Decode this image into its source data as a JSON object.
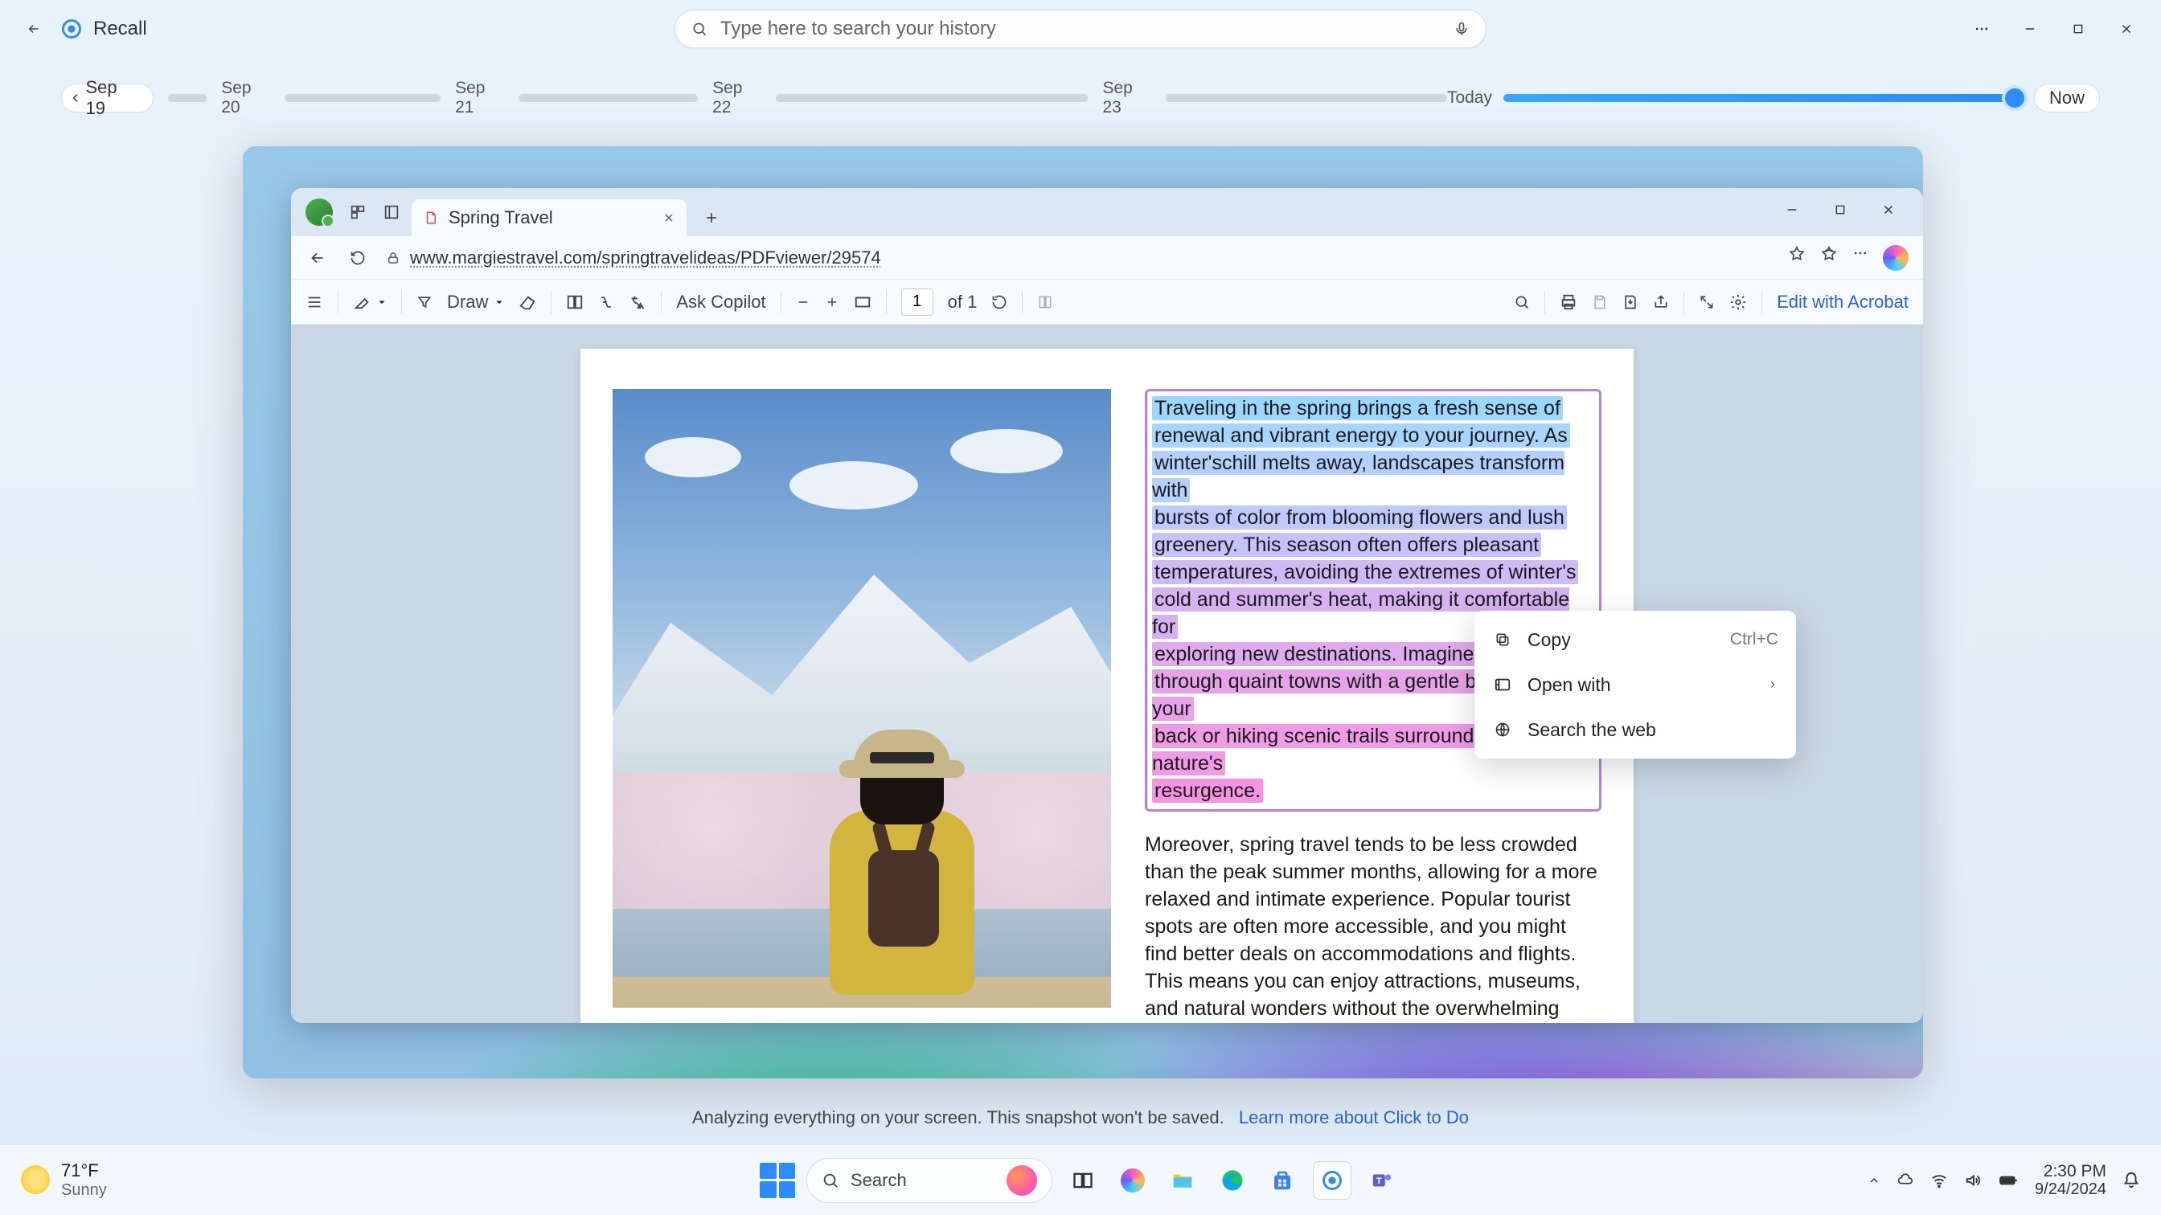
{
  "recall": {
    "title": "Recall",
    "search_placeholder": "Type here to search your history",
    "timeline": {
      "start_date": "Sep 19",
      "dates": [
        "Sep 20",
        "Sep 21",
        "Sep 22",
        "Sep 23"
      ],
      "today_label": "Today",
      "now_label": "Now"
    }
  },
  "status": {
    "text": "Analyzing everything on your screen. This snapshot won't be saved.",
    "link": "Learn more about Click to Do"
  },
  "edge": {
    "tab_title": "Spring Travel",
    "url": "www.margiestravel.com/springtravelideas/PDFviewer/29574",
    "pdf_toolbar": {
      "draw": "Draw",
      "ask_copilot": "Ask Copilot",
      "page_current": "1",
      "page_total": "of 1",
      "edit_acrobat": "Edit with Acrobat"
    },
    "document": {
      "highlighted_lines": [
        "Traveling in the spring brings a fresh sense of",
        "renewal and vibrant energy to your journey. As",
        "winter'schill melts away, landscapes transform with",
        "bursts of color from blooming flowers and lush",
        "greenery. This season often offers pleasant",
        "temperatures, avoiding the extremes of winter's",
        "cold and summer's heat, making it comfortable for",
        "exploring new destinations. Imagine strolling",
        "through quaint towns with a gentle breeze at your",
        "back or hiking scenic trails surrounded by nature's",
        "resurgence."
      ],
      "paragraph2": "Moreover, spring travel tends to be less crowded than the peak summer months, allowing for a more relaxed and intimate experience. Popular tourist spots are often more accessible, and you might find better deals on accommodations and flights. This means you can enjoy attractions, museums, and natural wonders without the overwhelming hustle and bustle. There's also something particularly enchanting about local festivals and events celebrating the arrival of spring, which provide a deeper connection to the culture and traditions of the place you're visiting."
    }
  },
  "context_menu": {
    "items": [
      {
        "label": "Copy",
        "shortcut": "Ctrl+C",
        "has_submenu": false
      },
      {
        "label": "Open with",
        "shortcut": "",
        "has_submenu": true
      },
      {
        "label": "Search the web",
        "shortcut": "",
        "has_submenu": false
      }
    ]
  },
  "taskbar": {
    "weather_temp": "71°F",
    "weather_cond": "Sunny",
    "search_label": "Search",
    "clock_time": "2:30 PM",
    "clock_date": "9/24/2024"
  }
}
